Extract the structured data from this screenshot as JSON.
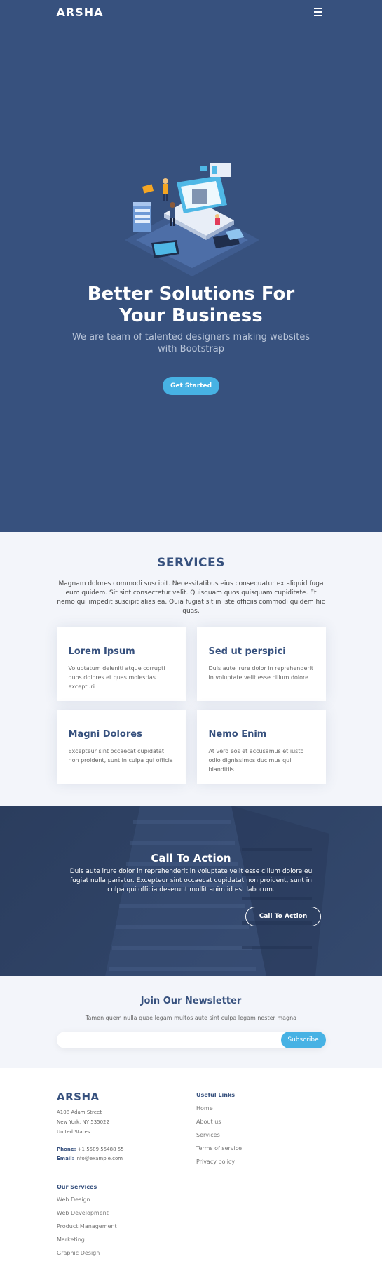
{
  "header": {
    "logo": "ARSHA",
    "menu_icon": "hamburger-menu-icon"
  },
  "hero": {
    "title": "Better Solutions For Your Business",
    "subtitle": "We are team of talented designers making websites with Bootstrap",
    "cta_label": "Get Started"
  },
  "services": {
    "title": "SERVICES",
    "description": "Magnam dolores commodi suscipit. Necessitatibus eius consequatur ex aliquid fuga eum quidem. Sit sint consectetur velit. Quisquam quos quisquam cupiditate. Et nemo qui impedit suscipit alias ea. Quia fugiat sit in iste officiis commodi quidem hic quas.",
    "cards": [
      {
        "title": "Lorem Ipsum",
        "text": "Voluptatum deleniti atque corrupti quos dolores et quas molestias excepturi"
      },
      {
        "title": "Sed ut perspici",
        "text": "Duis aute irure dolor in reprehenderit in voluptate velit esse cillum dolore"
      },
      {
        "title": "Magni Dolores",
        "text": "Excepteur sint occaecat cupidatat non proident, sunt in culpa qui officia"
      },
      {
        "title": "Nemo Enim",
        "text": "At vero eos et accusamus et iusto odio dignissimos ducimus qui blanditiis"
      }
    ]
  },
  "cta": {
    "title": "Call To Action",
    "text": "Duis aute irure dolor in reprehenderit in voluptate velit esse cillum dolore eu fugiat nulla pariatur. Excepteur sint occaecat cupidatat non proident, sunt in culpa qui officia deserunt mollit anim id est laborum.",
    "button_label": "Call To Action"
  },
  "newsletter": {
    "title": "Join Our Newsletter",
    "text": "Tamen quem nulla quae legam multos aute sint culpa legam noster magna",
    "input_value": "",
    "button_label": "Subscribe"
  },
  "footer": {
    "logo": "ARSHA",
    "address": [
      "A108 Adam Street",
      "New York, NY 535022",
      "United States"
    ],
    "phone_label": "Phone:",
    "phone": "+1 5589 55488 55",
    "email_label": "Email:",
    "email": "info@example.com",
    "useful_links_title": "Useful Links",
    "useful_links": [
      "Home",
      "About us",
      "Services",
      "Terms of service",
      "Privacy policy"
    ],
    "services_title": "Our Services",
    "services": [
      "Web Design",
      "Web Development",
      "Product Management",
      "Marketing",
      "Graphic Design"
    ]
  },
  "colors": {
    "primary_dark": "#37517e",
    "accent": "#47b2e4",
    "light_bg": "#f3f5fa"
  }
}
